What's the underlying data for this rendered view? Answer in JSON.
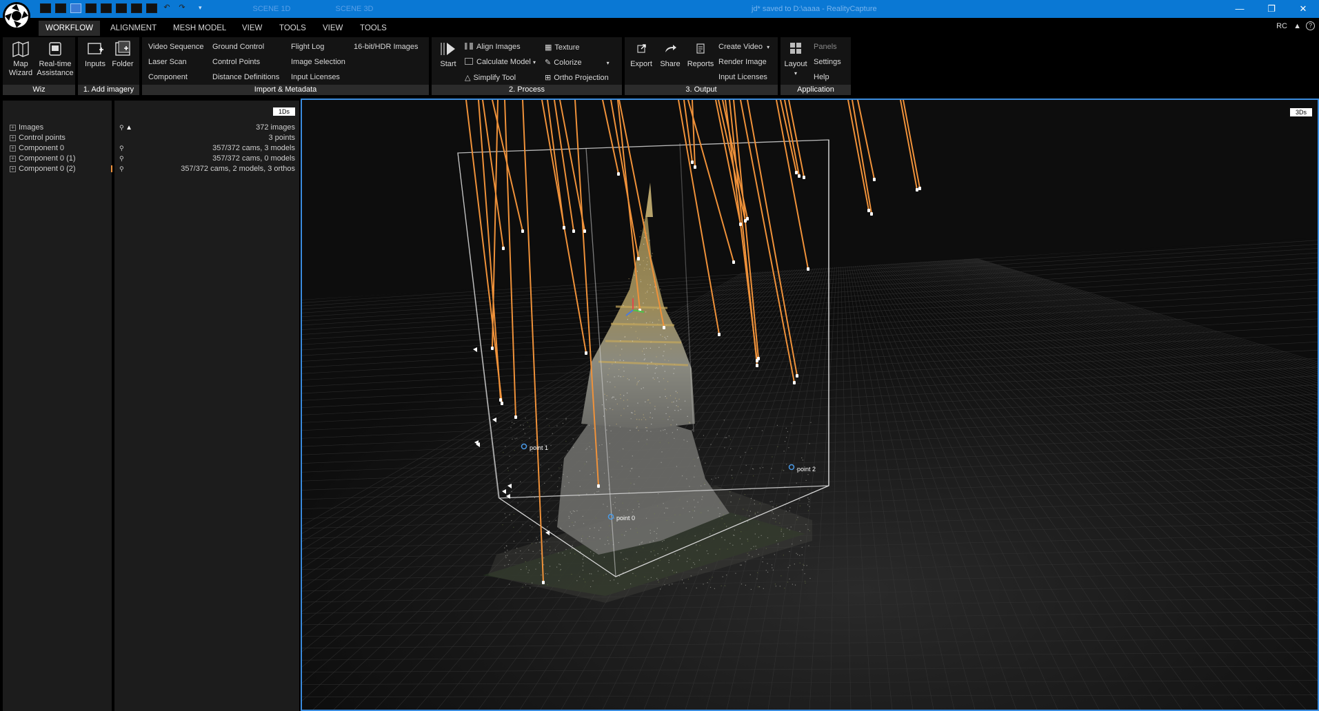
{
  "titlebar": {
    "scene_1d": "SCENE 1D",
    "scene_3d": "SCENE 3D",
    "document_status": "jd* saved to D:\\aaaa - RealityCapture",
    "minimize": "—",
    "restore": "❐",
    "close": "✕"
  },
  "menu": {
    "tabs": [
      "WORKFLOW",
      "ALIGNMENT",
      "MESH MODEL",
      "VIEW",
      "TOOLS",
      "VIEW",
      "TOOLS"
    ],
    "right_label": "RC"
  },
  "ribbon": {
    "wiz": {
      "title": "Wiz",
      "map_wizard": [
        "Map",
        "Wizard"
      ],
      "realtime_assistance": [
        "Real-time",
        "Assistance"
      ]
    },
    "add_imagery": {
      "title": "1. Add imagery",
      "inputs": "Inputs",
      "folder": "Folder"
    },
    "import": {
      "title": "Import & Metadata",
      "col1": [
        "Video Sequence",
        "Laser Scan",
        "Component"
      ],
      "col2": [
        "Ground Control",
        "Control Points",
        "Distance Definitions"
      ],
      "col3": [
        "Flight Log",
        "Image Selection",
        "Input Licenses"
      ],
      "col4": [
        "16-bit/HDR Images"
      ]
    },
    "process": {
      "title": "2. Process",
      "start": "Start",
      "col1": [
        "Align Images",
        "Calculate Model",
        "Simplify Tool"
      ],
      "col2": [
        "Texture",
        "Colorize",
        "Ortho Projection"
      ]
    },
    "output": {
      "title": "3. Output",
      "export": "Export",
      "share": "Share",
      "reports": "Reports",
      "col": [
        "Create Video",
        "Render Image",
        "Input Licenses"
      ]
    },
    "application": {
      "title": "Application",
      "layout": "Layout",
      "col": [
        "Panels",
        "Settings",
        "Help"
      ]
    }
  },
  "panel_1ds": {
    "badge": "1Ds",
    "tree": [
      {
        "label": "Images",
        "value": "372 images"
      },
      {
        "label": "Control points",
        "value": "3 points"
      },
      {
        "label": "Component 0",
        "value": "357/372 cams, 3 models"
      },
      {
        "label": "Component 0 (1)",
        "value": "357/372 cams, 0 models"
      },
      {
        "label": "Component 0 (2)",
        "value": "357/372 cams, 2 models, 3 orthos"
      }
    ]
  },
  "viewport_3d": {
    "badge": "3Ds",
    "points": [
      "point 0",
      "point 1",
      "point 2"
    ]
  },
  "colors": {
    "accent_blue": "#0a78d4",
    "camera_ray_orange": "#f0923a",
    "viewport_border": "#3b8de0"
  }
}
